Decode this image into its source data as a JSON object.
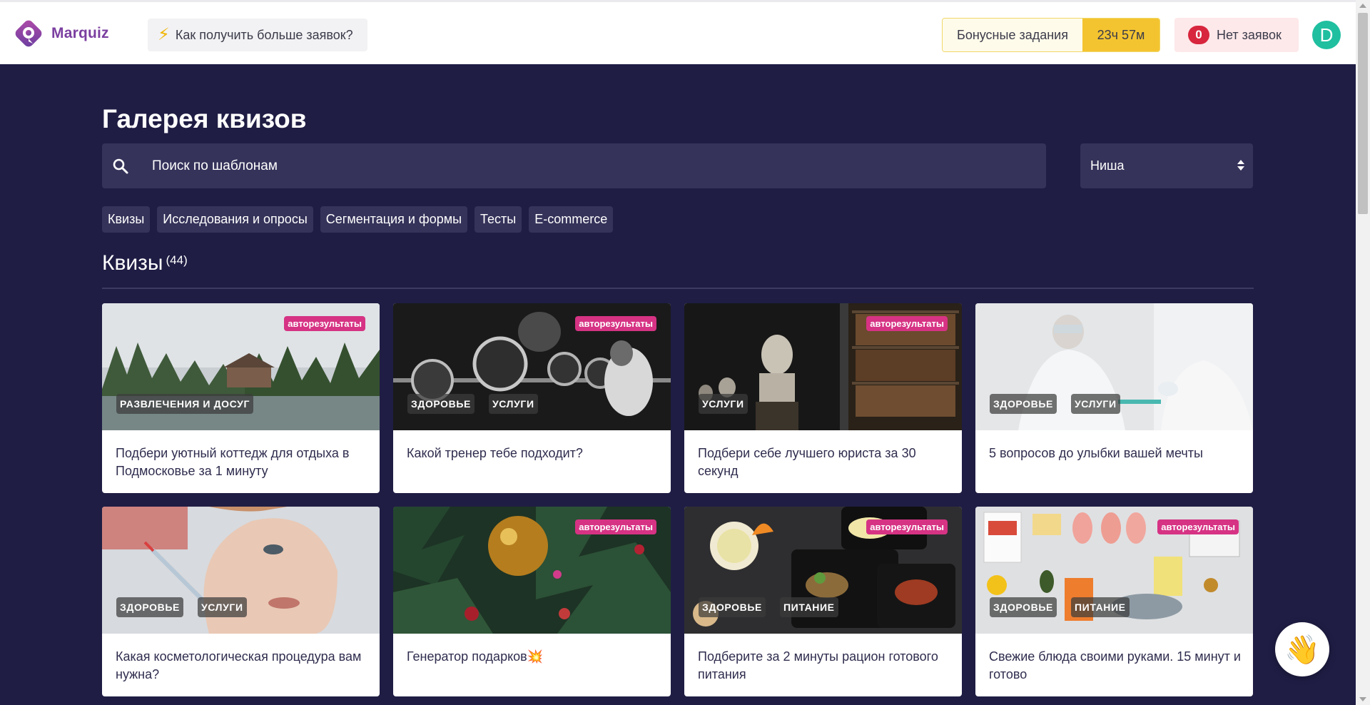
{
  "header": {
    "logo_text": "Marquiz",
    "howto_label": "Как получить больше заявок?",
    "bonus_label": "Бонусные задания",
    "bonus_timer": "23ч 57м",
    "leads_count": "0",
    "leads_label": "Нет заявок",
    "avatar_letter": "D"
  },
  "gallery": {
    "title": "Галерея квизов",
    "search_placeholder": "Поиск по шаблонам",
    "niche_select": "Ниша",
    "chips": [
      "Квизы",
      "Исследования и опросы",
      "Сегментация и формы",
      "Тесты",
      "E-commerce"
    ],
    "section_title": "Квизы",
    "section_count": "(44)"
  },
  "cards": [
    {
      "badge": "авторезультаты",
      "tags": [
        "РАЗВЛЕЧЕНИЯ И ДОСУГ"
      ],
      "title": "Подбери уютный коттедж для отдыха в Подмосковье за 1 минуту"
    },
    {
      "badge": "авторезультаты",
      "tags": [
        "ЗДОРОВЬЕ",
        "УСЛУГИ"
      ],
      "title": "Какой тренер тебе подходит?"
    },
    {
      "badge": "авторезультаты",
      "tags": [
        "УСЛУГИ"
      ],
      "title": "Подбери себе лучшего юриста за 30 секунд"
    },
    {
      "badge": "",
      "tags": [
        "ЗДОРОВЬЕ",
        "УСЛУГИ"
      ],
      "title": "5 вопросов до улыбки вашей мечты"
    },
    {
      "badge": "",
      "tags": [
        "ЗДОРОВЬЕ",
        "УСЛУГИ"
      ],
      "title": "Какая косметологическая процедура вам нужна?"
    },
    {
      "badge": "авторезультаты",
      "tags": [],
      "title": "Генератор подарков💥"
    },
    {
      "badge": "авторезультаты",
      "tags": [
        "ЗДОРОВЬЕ",
        "ПИТАНИЕ"
      ],
      "title": "Подберите за 2 минуты рацион готового питания"
    },
    {
      "badge": "авторезультаты",
      "tags": [
        "ЗДОРОВЬЕ",
        "ПИТАНИЕ"
      ],
      "title": "Свежие блюда своими руками. 15 минут и готово"
    }
  ],
  "chat_button_icon": "waving-hand-icon",
  "colors": {
    "background": "#1f1d44",
    "panel": "#35335a",
    "badge": "#d63384",
    "brand": "#7b3fa0",
    "bonus_accent": "#f4c430",
    "leads_badge": "#d7263d",
    "avatar": "#1fbfa0"
  }
}
